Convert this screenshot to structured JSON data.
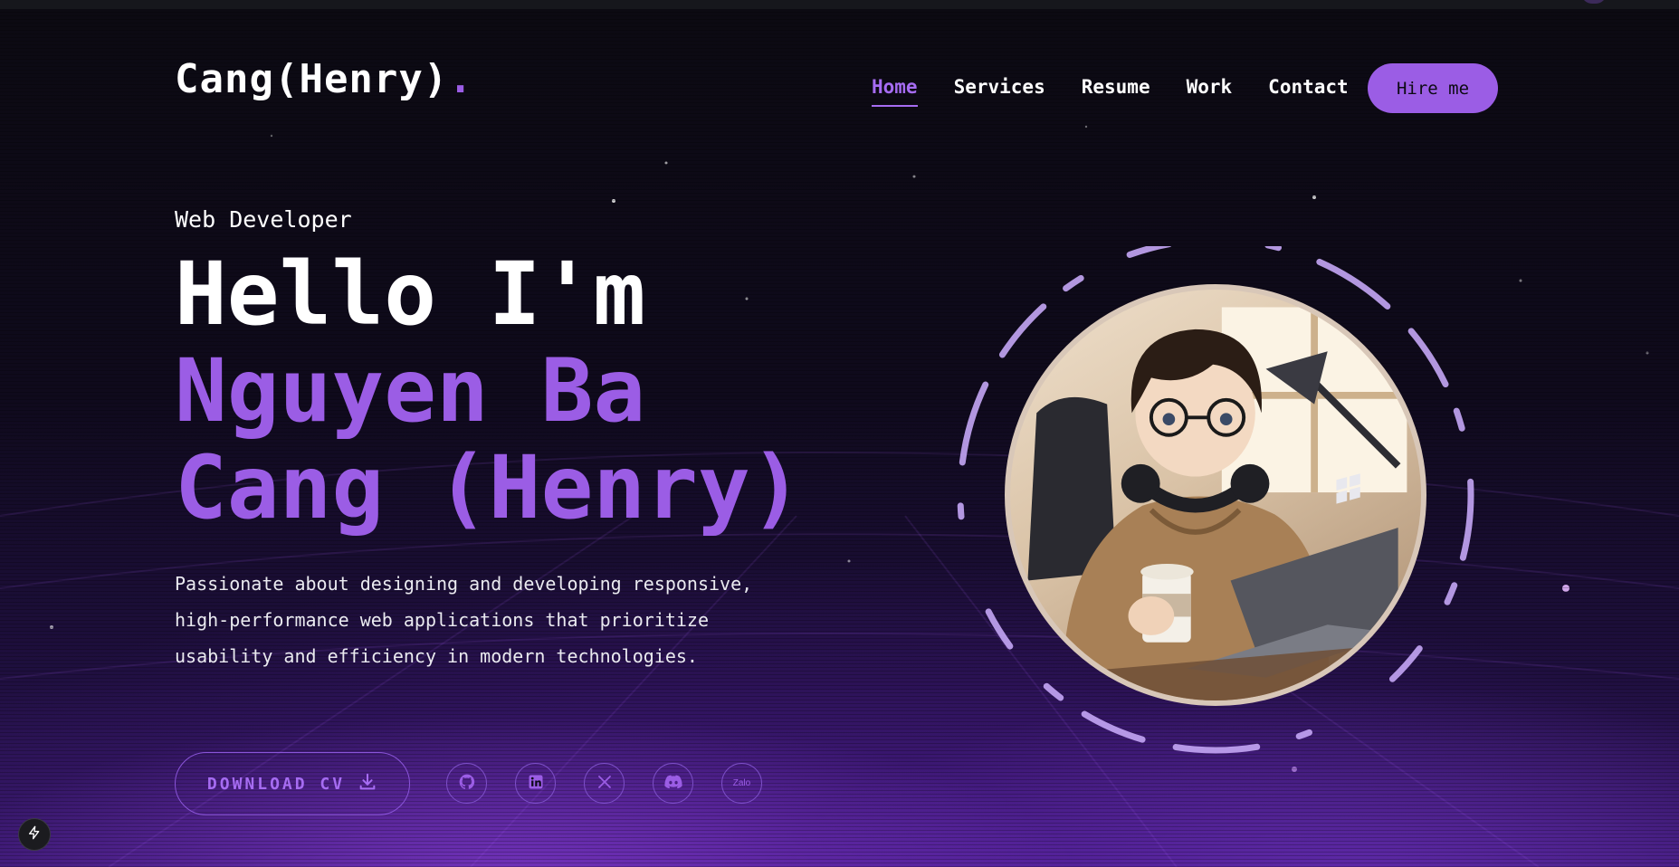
{
  "header": {
    "logo_text": "Cang(Henry)",
    "logo_dot": ".",
    "nav": [
      {
        "label": "Home",
        "active": true
      },
      {
        "label": "Services",
        "active": false
      },
      {
        "label": "Resume",
        "active": false
      },
      {
        "label": "Work",
        "active": false
      },
      {
        "label": "Contact",
        "active": false
      }
    ],
    "hire_label": "Hire me"
  },
  "hero": {
    "role": "Web Developer",
    "greeting": "Hello I'm",
    "name_line1": "Nguyen Ba",
    "name_line2": "Cang (Henry)",
    "description": "Passionate about designing and developing responsive, high-performance web applications that prioritize usability and efficiency in modern technologies.",
    "download_label": "DOWNLOAD CV",
    "socials": [
      {
        "name": "github-icon",
        "label": ""
      },
      {
        "name": "linkedin-icon",
        "label": ""
      },
      {
        "name": "x-icon",
        "label": ""
      },
      {
        "name": "discord-icon",
        "label": ""
      },
      {
        "name": "zalo-icon",
        "label": "Zalo"
      }
    ]
  },
  "colors": {
    "accent": "#9b5de5",
    "background": "#0c0b12",
    "text": "#ffffff"
  }
}
